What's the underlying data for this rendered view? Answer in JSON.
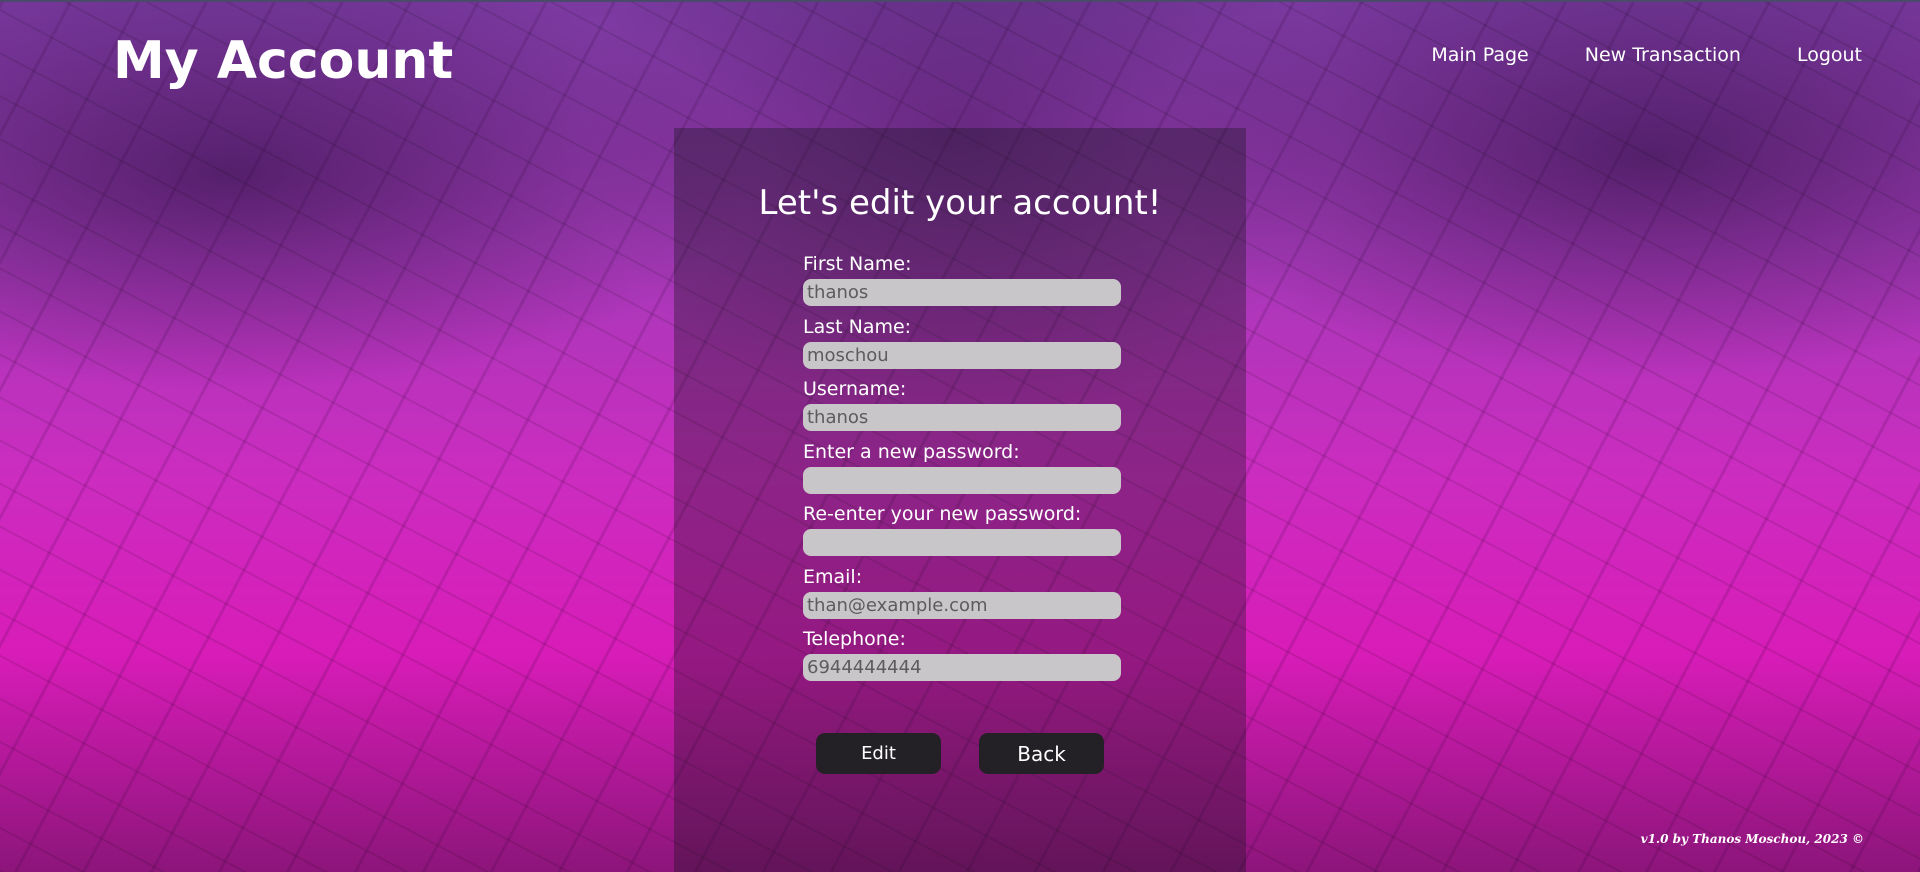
{
  "header": {
    "title": "My Account",
    "nav": [
      "Main Page",
      "New Transaction",
      "Logout"
    ]
  },
  "form": {
    "heading": "Let's edit your account!",
    "fields": [
      {
        "label": "First Name:",
        "value": "thanos"
      },
      {
        "label": "Last Name:",
        "value": "moschou"
      },
      {
        "label": "Username:",
        "value": "thanos"
      },
      {
        "label": "Enter a new password:",
        "value": ""
      },
      {
        "label": "Re-enter your new password:",
        "value": ""
      },
      {
        "label": "Email:",
        "value": "than@example.com"
      },
      {
        "label": "Telephone:",
        "value": "6944444444"
      }
    ],
    "edit_label": "Edit",
    "back_label": "Back"
  },
  "footer": {
    "text": "v1.0 by Thanos Moschou, 2023 ©"
  },
  "colors": {
    "background_accent": "#d81cb8",
    "input_background": "#c9c6ca",
    "button_background": "#242126"
  }
}
